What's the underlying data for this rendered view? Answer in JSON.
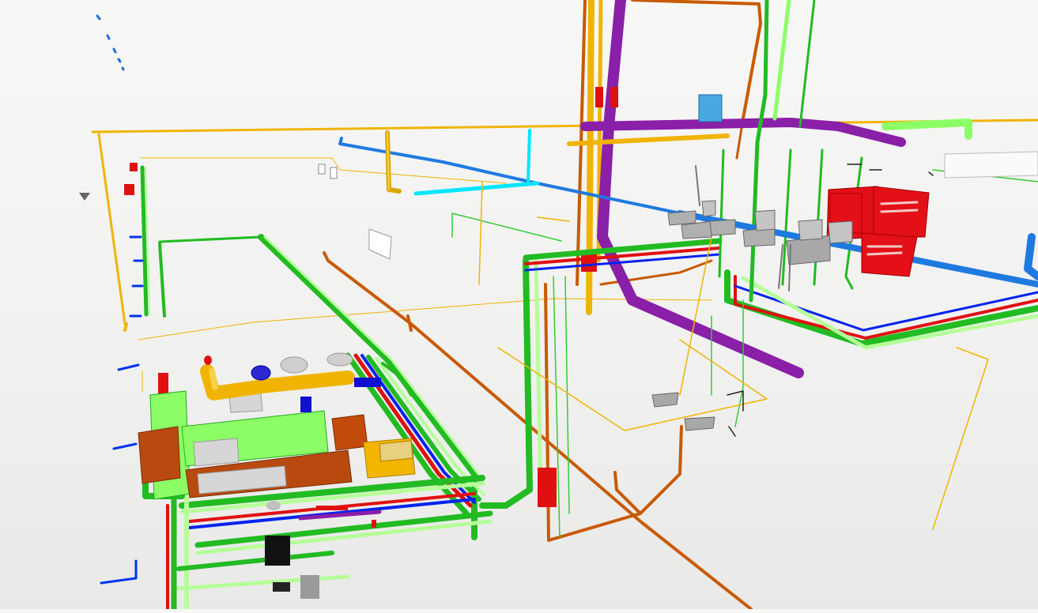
{
  "viewer": {
    "background": "#f2f2f1",
    "view_mode": "3d-perspective"
  },
  "systems": {
    "domestic_hot_water": "#ff0000",
    "domestic_cold_water": "#0033ff",
    "heating_supply": "#00cc00",
    "heating_return": "#99ff66",
    "sanitary_waste": "#c85a00",
    "gas": "#ffc61a",
    "ventilation_supply": "#00e6ff",
    "ventilation_exhaust": "#1f7ae0",
    "circulation": "#8a1fa8",
    "equipment": "#d8d8d8",
    "distribution_board": "#e0101a"
  },
  "icons": {
    "nav_marker": "triangle-down-icon"
  }
}
